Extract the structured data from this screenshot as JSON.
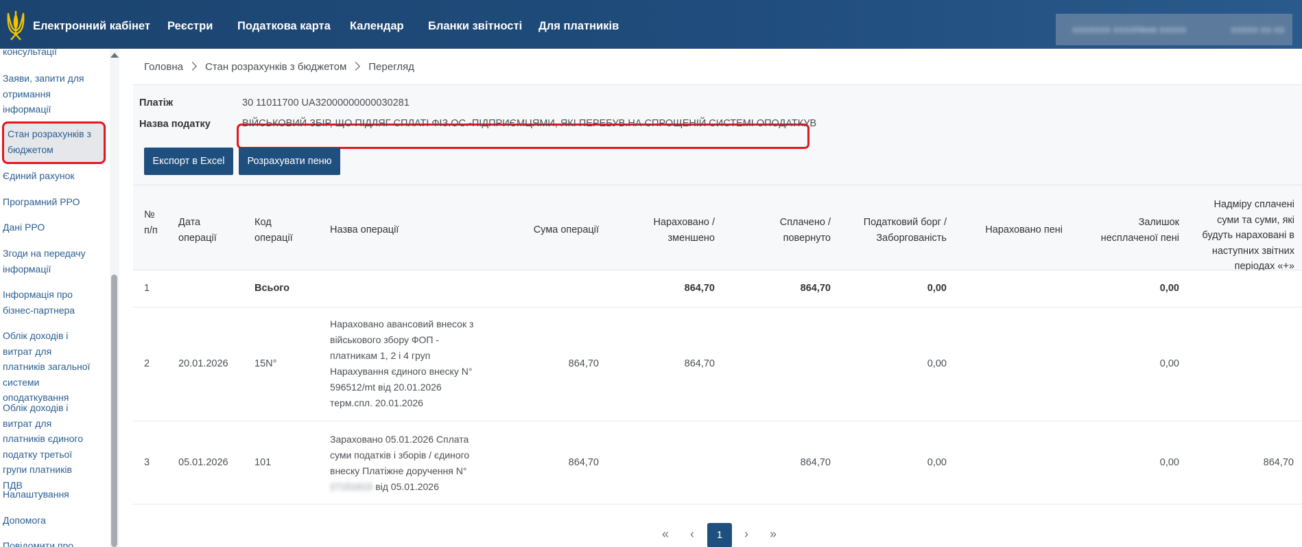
{
  "header": {
    "brand": "Електронний кабінет",
    "nav": [
      "Реєстри",
      "Податкова карта",
      "Календар",
      "Бланки звітності",
      "Для платників"
    ],
    "user_name": "ХХХХХХХ ХХХХРАНА ХХХХХ",
    "user_id": "ХХХХХ ХХ ХХ"
  },
  "sidebar": {
    "items": [
      "консультації",
      "Заяви, запити для отримання інформації",
      "Стан розрахунків з бюджетом",
      "Єдиний рахунок",
      "Програмний РРО",
      "Дані РРО",
      "Згоди на передачу інформації",
      "Інформація про бізнес-партнера",
      "Облік доходів і витрат для платників загальної системи оподаткування",
      "Облік доходів і витрат для платників єдиного податку третьої групи платників ПДВ",
      "Налаштування",
      "Допомога",
      "Повідомити про"
    ]
  },
  "breadcrumb": [
    "Головна",
    "Стан розрахунків з бюджетом",
    "Перегляд"
  ],
  "payment": {
    "label": "Платіж",
    "value": "30 11011700 UA32000000000030281",
    "tax_label": "Назва податку",
    "tax_value": "ВІЙСЬКОВИЙ ЗБІР, ЩО ПІДЛЯГ СПЛАТІ ФІЗ.ОС.-ПІДПРИЄМЦЯМИ, ЯКІ ПЕРЕБУВ.НА СПРОЩЕНІЙ СИСТЕМІ ОПОДАТКУВ"
  },
  "buttons": {
    "export": "Експорт в Excel",
    "calc": "Розрахувати пеню"
  },
  "table": {
    "headers": [
      "№ п/п",
      "Дата операції",
      "Код операції",
      "Назва операції",
      "Сума операції",
      "Нараховано / зменшено",
      "Сплачено / повернуто",
      "Податковий борг / Заборгованість",
      "Нараховано пені",
      "Залишок несплаченої пені",
      "Надміру сплачені суми та суми, які будуть нараховані в наступних звітних періодах «+»"
    ],
    "rows": [
      {
        "num": "1",
        "date": "",
        "code": "Всього",
        "name": "",
        "sum": "",
        "accrued": "864,70",
        "paid": "864,70",
        "debt": "0,00",
        "penalty": "",
        "penalty_rest": "0,00",
        "overpaid": ""
      },
      {
        "num": "2",
        "date": "20.01.2026",
        "code": "15N°",
        "name": "Нараховано авансовий внесок з військового збору ФОП - платникам 1, 2 і 4 груп Нарахування єдиного внеску N° 596512/mt від 20.01.2026 терм.спл. 20.01.2026",
        "sum": "864,70",
        "accrued": "864,70",
        "paid": "",
        "debt": "0,00",
        "penalty": "",
        "penalty_rest": "0,00",
        "overpaid": ""
      },
      {
        "num": "3",
        "date": "05.01.2026",
        "code": "101",
        "name": "Зараховано 05.01.2026 Сплата суми податків і зборів / єдиного внеску Платіжне доручення N°",
        "name_hidden": "27151615",
        "name_tail": "від 05.01.2026",
        "sum": "864,70",
        "accrued": "",
        "paid": "864,70",
        "debt": "0,00",
        "penalty": "",
        "penalty_rest": "0,00",
        "overpaid": "864,70"
      }
    ]
  },
  "pagination": {
    "first": "«",
    "prev": "‹",
    "current": "1",
    "next": "›",
    "last": "»"
  }
}
